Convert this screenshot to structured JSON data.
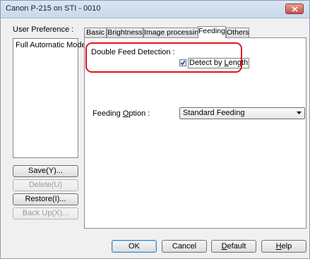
{
  "window": {
    "title": "Canon P-215 on STI - 0010"
  },
  "sidebar": {
    "user_preference_label": "User Preference :",
    "preferences": [
      "Full Automatic Mode"
    ],
    "buttons": {
      "save": "Save(Y)...",
      "delete": "Delete(U)",
      "restore": "Restore(I)...",
      "backup": "Back Up(X)..."
    }
  },
  "tabs": [
    {
      "label": "Basic",
      "active": false
    },
    {
      "label": "Brightness",
      "active": false
    },
    {
      "label": "Image processing",
      "active": false
    },
    {
      "label": "Feeding",
      "active": true
    },
    {
      "label": "Others",
      "active": false
    }
  ],
  "feeding": {
    "double_feed_label": "Double Feed Detection :",
    "detect_by_length_label": "Detect by Length",
    "detect_by_length_checked": true,
    "feeding_option_label": "Feeding Option :",
    "feeding_option_value": "Standard Feeding"
  },
  "footer": {
    "ok": "OK",
    "cancel": "Cancel",
    "default": "Default",
    "help": "Help"
  },
  "colors": {
    "highlight": "#e3151d",
    "close_button": "#c75050"
  }
}
